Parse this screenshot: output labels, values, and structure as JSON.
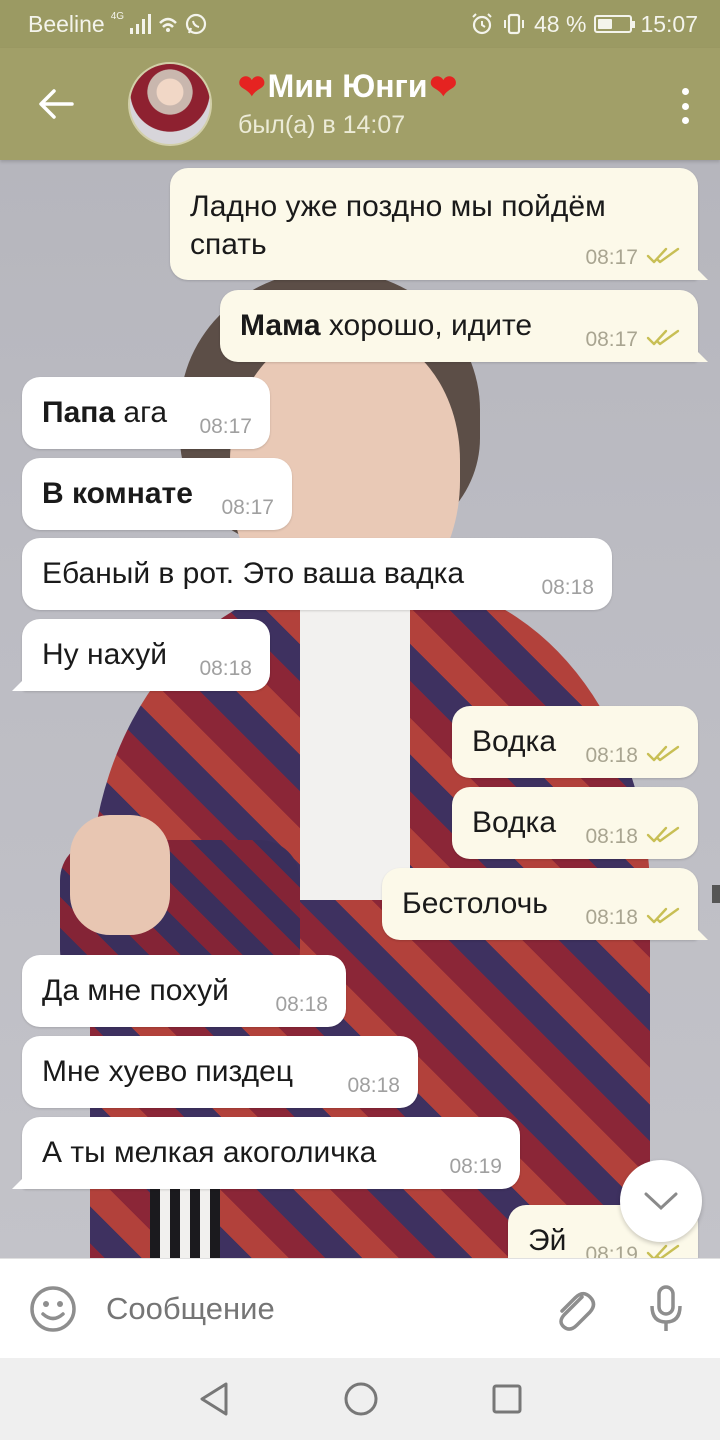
{
  "status_bar": {
    "carrier": "Beeline",
    "network": "4G",
    "battery": "48 %",
    "battery_level": 0.48,
    "time": "15:07"
  },
  "header": {
    "title_name": "Мин Юнги",
    "status": "был(а) в 14:07",
    "icons": [
      "back-arrow-icon",
      "avatar",
      "more-vertical-icon"
    ]
  },
  "messages": [
    {
      "dir": "out",
      "text": "Ладно уже поздно мы пойдём спать",
      "time": "08:17"
    },
    {
      "dir": "out",
      "bold": "Мама",
      "text": " хорошо, идите",
      "time": "08:17"
    },
    {
      "dir": "in",
      "bold": "Папа",
      "text": " ага",
      "time": "08:17"
    },
    {
      "dir": "in",
      "bold": "В комнате",
      "text": "",
      "time": "08:17"
    },
    {
      "dir": "in",
      "text": "Ебаный в рот. Это ваша вадка",
      "time": "08:18"
    },
    {
      "dir": "in",
      "text": "Ну нахуй",
      "time": "08:18"
    },
    {
      "dir": "out",
      "text": "Водка",
      "time": "08:18"
    },
    {
      "dir": "out",
      "text": "Водка",
      "time": "08:18"
    },
    {
      "dir": "out",
      "text": "Бестолочь",
      "time": "08:18"
    },
    {
      "dir": "in",
      "text": "Да мне похуй",
      "time": "08:18"
    },
    {
      "dir": "in",
      "text": "Мне хуево пиздец",
      "time": "08:18"
    },
    {
      "dir": "in",
      "text": "А ты мелкая акоголичка",
      "time": "08:19"
    },
    {
      "dir": "out",
      "text": "Эй",
      "time": "08:19"
    }
  ],
  "composer": {
    "placeholder": "Сообщение",
    "icons": [
      "emoji-icon",
      "attach-icon",
      "mic-icon"
    ]
  },
  "colors": {
    "header": "#a19f68",
    "status_bar": "#9b9a63",
    "outgoing_bubble": "#fcf9e9",
    "incoming_bubble": "#ffffff",
    "read_check": "#c8bf55"
  }
}
